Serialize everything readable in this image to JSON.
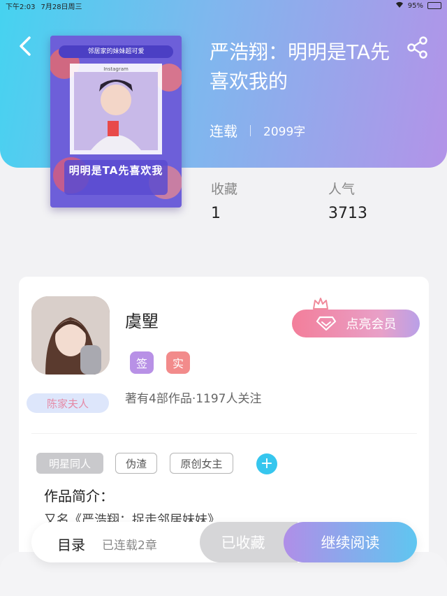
{
  "status_bar": {
    "time": "下午2:03",
    "date": "7月28日周三",
    "battery": "95%"
  },
  "book": {
    "cover": {
      "banner": "邻居家的妹妹超可爱",
      "caption": "Instagram",
      "title_art": "明明是TA先喜欢我"
    },
    "title": "严浩翔：明明是TA先喜欢我的",
    "status": "连载",
    "word_count": "2099字",
    "stats": [
      {
        "label": "收藏",
        "value": "1"
      },
      {
        "label": "人气",
        "value": "3713"
      }
    ]
  },
  "author": {
    "name": "虞朢",
    "badges": [
      "签",
      "实"
    ],
    "tag": "陈家夫人",
    "desc": "著有4部作品·1197人关注",
    "vip_label": "点亮会员"
  },
  "tags": [
    "明星同人",
    "伪渣",
    "原创女主"
  ],
  "intro": {
    "label": "作品简介：",
    "text": "又名《严浩翔：捉走邻居妹妹》"
  },
  "bottom": {
    "toc_label": "目录",
    "toc_count": "已连载2章",
    "collected_label": "已收藏",
    "read_label": "继续阅读"
  },
  "colors": {
    "accent_cyan": "#36c6ee",
    "accent_purple": "#b891e6",
    "accent_pink": "#f28b8b"
  }
}
